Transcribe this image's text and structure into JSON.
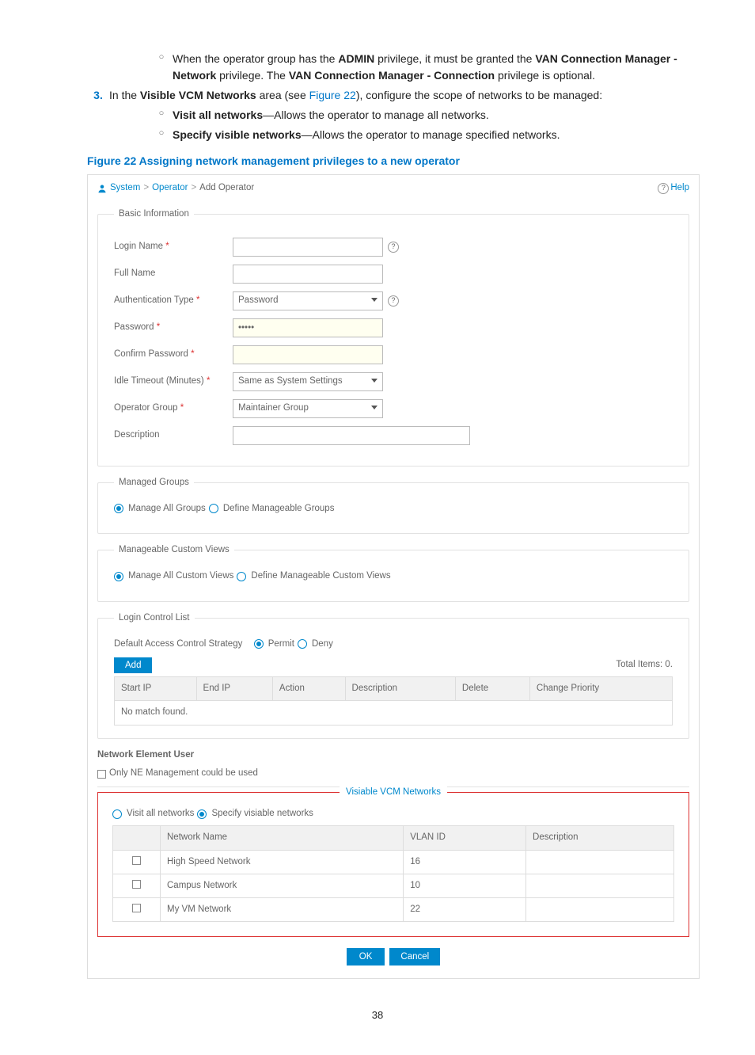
{
  "doc": {
    "bullet_admin": "When the operator group has the <b>ADMIN</b> privilege, it must be granted the <b>VAN Connection Manager - Network</b> privilege. The <b>VAN Connection Manager - Connection</b> privilege is optional.",
    "step3_num": "3.",
    "step3": "In the <b>Visible VCM Networks</b> area (see <span class=\"figref\">Figure 22</span>), configure the scope of networks to be managed:",
    "sub_visit": "<b>Visit all networks</b>—Allows the operator to manage all networks.",
    "sub_specify": "<b>Specify visible networks</b>—Allows the operator to manage specified networks.",
    "figcap": "Figure 22 Assigning network management privileges to a new operator",
    "pagenum": "38"
  },
  "breadcrumb": {
    "l1": "System",
    "l2": "Operator",
    "cur": "Add Operator",
    "help": "Help"
  },
  "basic": {
    "legend": "Basic Information",
    "login_label": "Login Name",
    "fullname_label": "Full Name",
    "authtype_label": "Authentication Type",
    "authtype_value": "Password",
    "password_label": "Password",
    "password_value": "•••••",
    "confirm_label": "Confirm Password",
    "idle_label": "Idle Timeout (Minutes)",
    "idle_value": "Same as System Settings",
    "group_label": "Operator Group",
    "group_value": "Maintainer Group",
    "desc_label": "Description"
  },
  "managed_groups": {
    "legend": "Managed Groups",
    "opt_all": "Manage All Groups",
    "opt_def": "Define Manageable Groups"
  },
  "custom_views": {
    "legend": "Manageable Custom Views",
    "opt_all": "Manage All Custom Views",
    "opt_def": "Define Manageable Custom Views"
  },
  "login_ctrl": {
    "legend": "Login Control List",
    "strategy_label": "Default Access Control Strategy",
    "opt_permit": "Permit",
    "opt_deny": "Deny",
    "add_btn": "Add",
    "total_items": "Total Items: 0.",
    "cols": {
      "start": "Start IP",
      "end": "End IP",
      "action": "Action",
      "desc": "Description",
      "del": "Delete",
      "prio": "Change Priority"
    },
    "empty": "No match found."
  },
  "neuser": {
    "title": "Network Element User",
    "only": "Only NE Management could be used"
  },
  "visible": {
    "legend": "Visiable VCM Networks",
    "opt_all": "Visit all networks",
    "opt_spec": "Specify visiable networks",
    "cols": {
      "name": "Network Name",
      "vlan": "VLAN ID",
      "desc": "Description"
    },
    "rows": [
      {
        "name": "High Speed Network",
        "vlan": "16",
        "desc": ""
      },
      {
        "name": "Campus Network",
        "vlan": "10",
        "desc": ""
      },
      {
        "name": "My VM Network",
        "vlan": "22",
        "desc": ""
      }
    ]
  },
  "buttons": {
    "ok": "OK",
    "cancel": "Cancel"
  }
}
